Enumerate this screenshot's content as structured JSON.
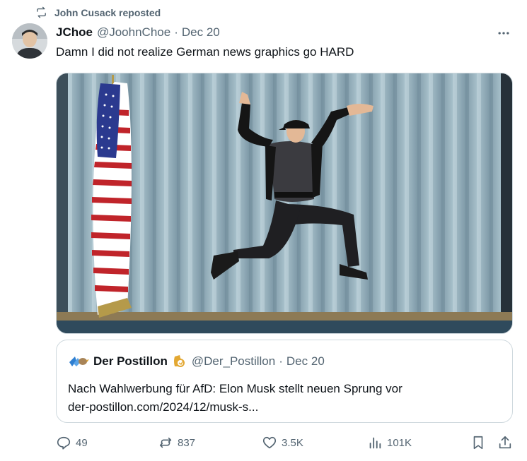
{
  "repost": {
    "label": "John Cusack reposted",
    "icon": "repost-icon"
  },
  "tweet": {
    "display_name": "JChoe",
    "handle": "@JoohnChoe",
    "separator": "·",
    "date": "Dec 20",
    "text": "Damn I did not realize German news graphics go HARD",
    "more_icon": "more-icon"
  },
  "quote": {
    "display_name": "Der Postillon",
    "handle": "@Der_Postillon",
    "separator": "·",
    "date": "Dec 20",
    "line1": "Nach Wahlwerbung für AfD: Elon Musk stellt neuen Sprung vor",
    "line2": "der-postillon.com/2024/12/musk-s..."
  },
  "actions": {
    "reply_count": "49",
    "repost_count": "837",
    "like_count": "3.5K",
    "view_count": "101K"
  },
  "colors": {
    "text": "#0f1419",
    "secondary": "#536471",
    "border": "#cfd9de"
  }
}
